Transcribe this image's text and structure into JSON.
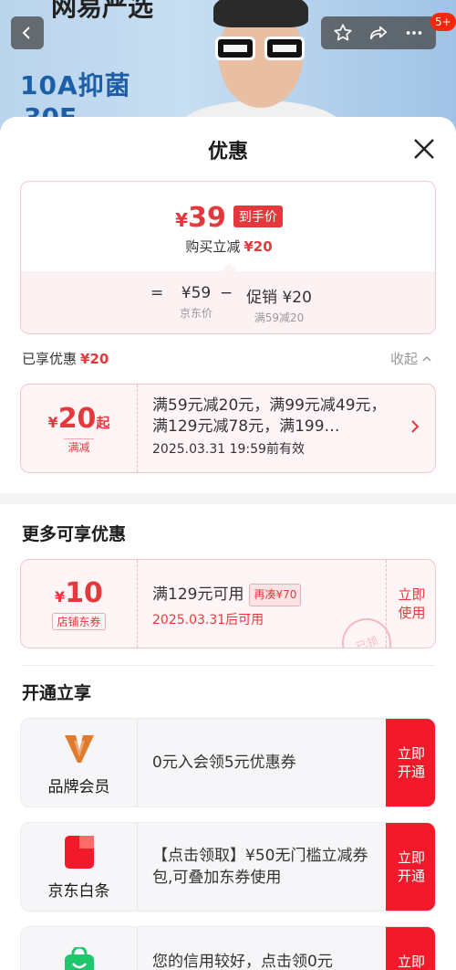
{
  "background": {
    "brand_line1": "10A抑菌",
    "brand_line2": "30F",
    "top_word": "网易严选"
  },
  "header": {
    "badge": "5+"
  },
  "sheet": {
    "title": "优惠"
  },
  "price": {
    "currency": "¥",
    "final": "39",
    "final_tag": "到手价",
    "reduce_label": "购买立减",
    "reduce_amount": "¥20",
    "eq": "=",
    "base_price": "¥59",
    "base_label": "京东价",
    "minus": "−",
    "promo_price": "促销 ¥20",
    "promo_label": "满59减20"
  },
  "enjoyed": {
    "label": "已享优惠",
    "amount": "¥20",
    "collapse": "收起"
  },
  "discount_coupon": {
    "currency": "¥",
    "amount": "20",
    "suffix": "起",
    "type": "满减",
    "desc": "满59元减20元，满99元减49元，满129元减78元，满199…",
    "date": "2025.03.31 19:59前有效"
  },
  "more": {
    "title": "更多可享优惠",
    "coupon": {
      "currency": "¥",
      "amount": "10",
      "type": "店铺东券",
      "condition": "满129元可用",
      "tag": "再凑¥70",
      "date": "2025.03.31后可用",
      "use": "立即使用",
      "stamp": "已领"
    }
  },
  "open": {
    "title": "开通立享",
    "cards": [
      {
        "name": "品牌会员",
        "text": "0元入会领5元优惠券",
        "btn": "立即开通"
      },
      {
        "name": "京东白条",
        "text": "【点击领取】¥50无门槛立减券包,可叠加东券使用",
        "btn": "立即开通",
        "logo_text": "白条"
      },
      {
        "name": "",
        "text": "您的信用较好，点击领0元",
        "btn": "立即"
      }
    ]
  },
  "colors": {
    "accent": "#e4393c",
    "button_red": "#f2192a"
  }
}
